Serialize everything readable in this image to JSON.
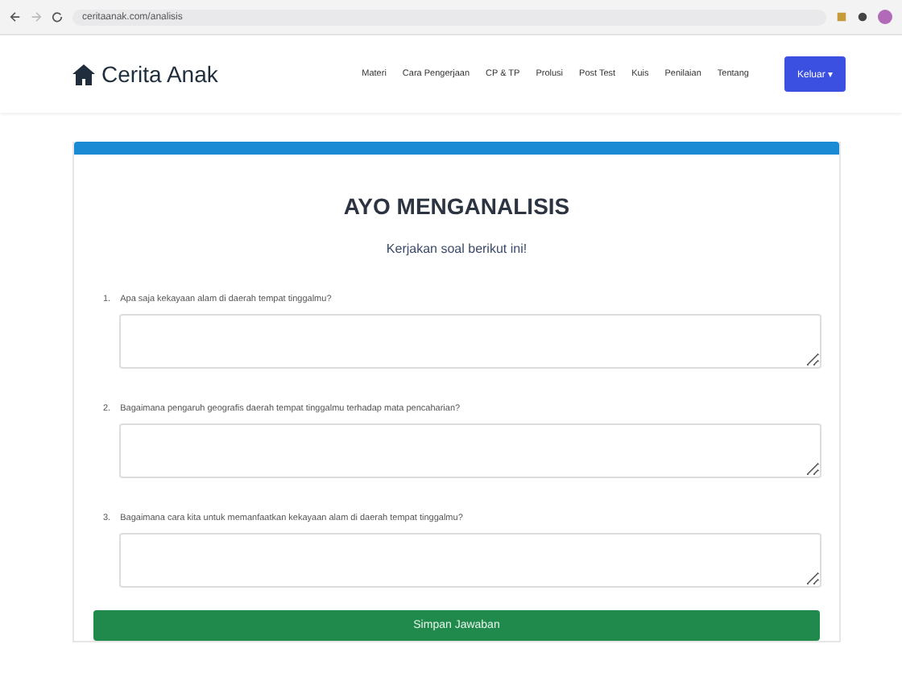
{
  "browser": {
    "url": "ceritaanak.com/analisis"
  },
  "navbar": {
    "brand": "Cerita Anak",
    "links": [
      "Materi",
      "Cara Pengerjaan",
      "CP & TP",
      "Prolusi",
      "Post Test",
      "Kuis",
      "Penilaian",
      "Tentang"
    ],
    "account_button": "Keluar ▾"
  },
  "card": {
    "title": "AYO MENGANALISIS",
    "subtitle": "Kerjakan soal berikut ini!",
    "questions": [
      {
        "number": "1.",
        "text": "Apa saja kekayaan alam di daerah tempat tinggalmu?"
      },
      {
        "number": "2.",
        "text": "Bagaimana pengaruh geografis daerah tempat tinggalmu terhadap mata pencaharian?"
      },
      {
        "number": "3.",
        "text": "Bagaimana cara kita untuk memanfaatkan kekayaan alam di daerah tempat tinggalmu?"
      }
    ],
    "submit_button": "Simpan Jawaban"
  }
}
